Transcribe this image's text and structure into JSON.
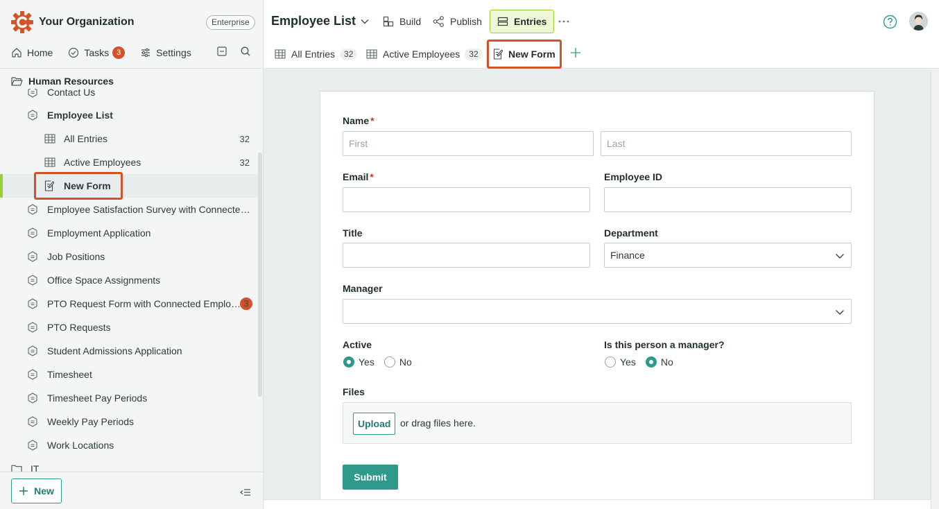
{
  "org": {
    "name": "Your Organization",
    "plan": "Enterprise"
  },
  "topnav": {
    "home": "Home",
    "tasks": "Tasks",
    "tasks_count": "3",
    "settings": "Settings"
  },
  "tree": {
    "group": "Human Resources",
    "items": [
      {
        "label": "Contact Us",
        "level": 1
      },
      {
        "label": "Employee List",
        "level": 1
      },
      {
        "label": "All Entries",
        "level": 2,
        "count": "32"
      },
      {
        "label": "Active Employees",
        "level": 2,
        "count": "32"
      },
      {
        "label": "New Form",
        "level": 2
      },
      {
        "label": "Employee Satisfaction Survey with Connecte…",
        "level": 1
      },
      {
        "label": "Employment Application",
        "level": 1
      },
      {
        "label": "Job Positions",
        "level": 1
      },
      {
        "label": "Office Space Assignments",
        "level": 1
      },
      {
        "label": "PTO Request Form with Connected Emplo…",
        "level": 1,
        "badge": "3"
      },
      {
        "label": "PTO Requests",
        "level": 1
      },
      {
        "label": "Student Admissions Application",
        "level": 1
      },
      {
        "label": "Timesheet",
        "level": 1
      },
      {
        "label": "Timesheet Pay Periods",
        "level": 1
      },
      {
        "label": "Weekly Pay Periods",
        "level": 1
      },
      {
        "label": "Work Locations",
        "level": 1
      }
    ],
    "next_group": "IT"
  },
  "bottom": {
    "new_label": "New"
  },
  "header": {
    "title": "Employee List",
    "build": "Build",
    "publish": "Publish",
    "entries": "Entries"
  },
  "tabs": [
    {
      "label": "All Entries",
      "count": "32"
    },
    {
      "label": "Active Employees",
      "count": "32"
    },
    {
      "label": "New Form"
    }
  ],
  "form": {
    "name_label": "Name",
    "first_placeholder": "First",
    "last_placeholder": "Last",
    "email_label": "Email",
    "employee_id_label": "Employee ID",
    "title_label": "Title",
    "department_label": "Department",
    "department_value": "Finance",
    "manager_label": "Manager",
    "active_label": "Active",
    "active_yes": "Yes",
    "active_no": "No",
    "active_selected": "Yes",
    "is_manager_label": "Is this person a manager?",
    "is_manager_yes": "Yes",
    "is_manager_no": "No",
    "is_manager_selected": "No",
    "files_label": "Files",
    "upload_label": "Upload",
    "drop_text": "or drag files here.",
    "submit_label": "Submit"
  },
  "colors": {
    "accent": "#2e9a8c",
    "highlight": "#d4522a",
    "active_green": "#9bd138"
  }
}
